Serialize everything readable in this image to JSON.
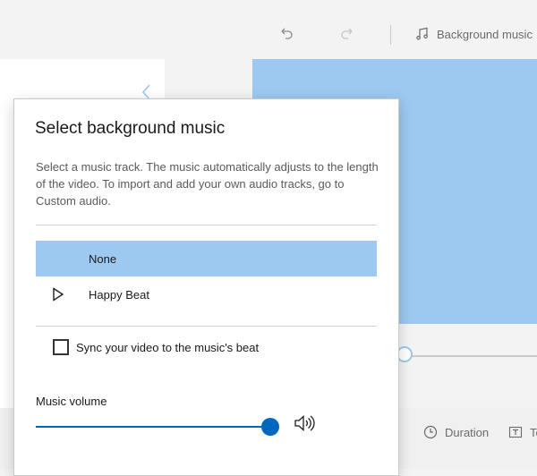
{
  "toolbar": {
    "undo_icon": "undo-icon",
    "redo_icon": "redo-icon",
    "background_music_label": "Background music"
  },
  "bottom_bar": {
    "duration_label": "Duration",
    "text_label": "Te"
  },
  "dialog": {
    "title": "Select background music",
    "description": "Select a music track. The music automatically adjusts to the length of the video. To import and add your own audio tracks, go to Custom audio.",
    "tracks": [
      {
        "label": "None",
        "selected": true
      },
      {
        "label": "Happy Beat",
        "selected": false
      }
    ],
    "sync_label": "Sync your video to the music's beat",
    "sync_checked": false,
    "volume_label": "Music volume",
    "volume_level": 1.0
  },
  "colors": {
    "accent": "#0067c0",
    "selection": "#9dc8ef",
    "preview": "#9dc8ef"
  }
}
